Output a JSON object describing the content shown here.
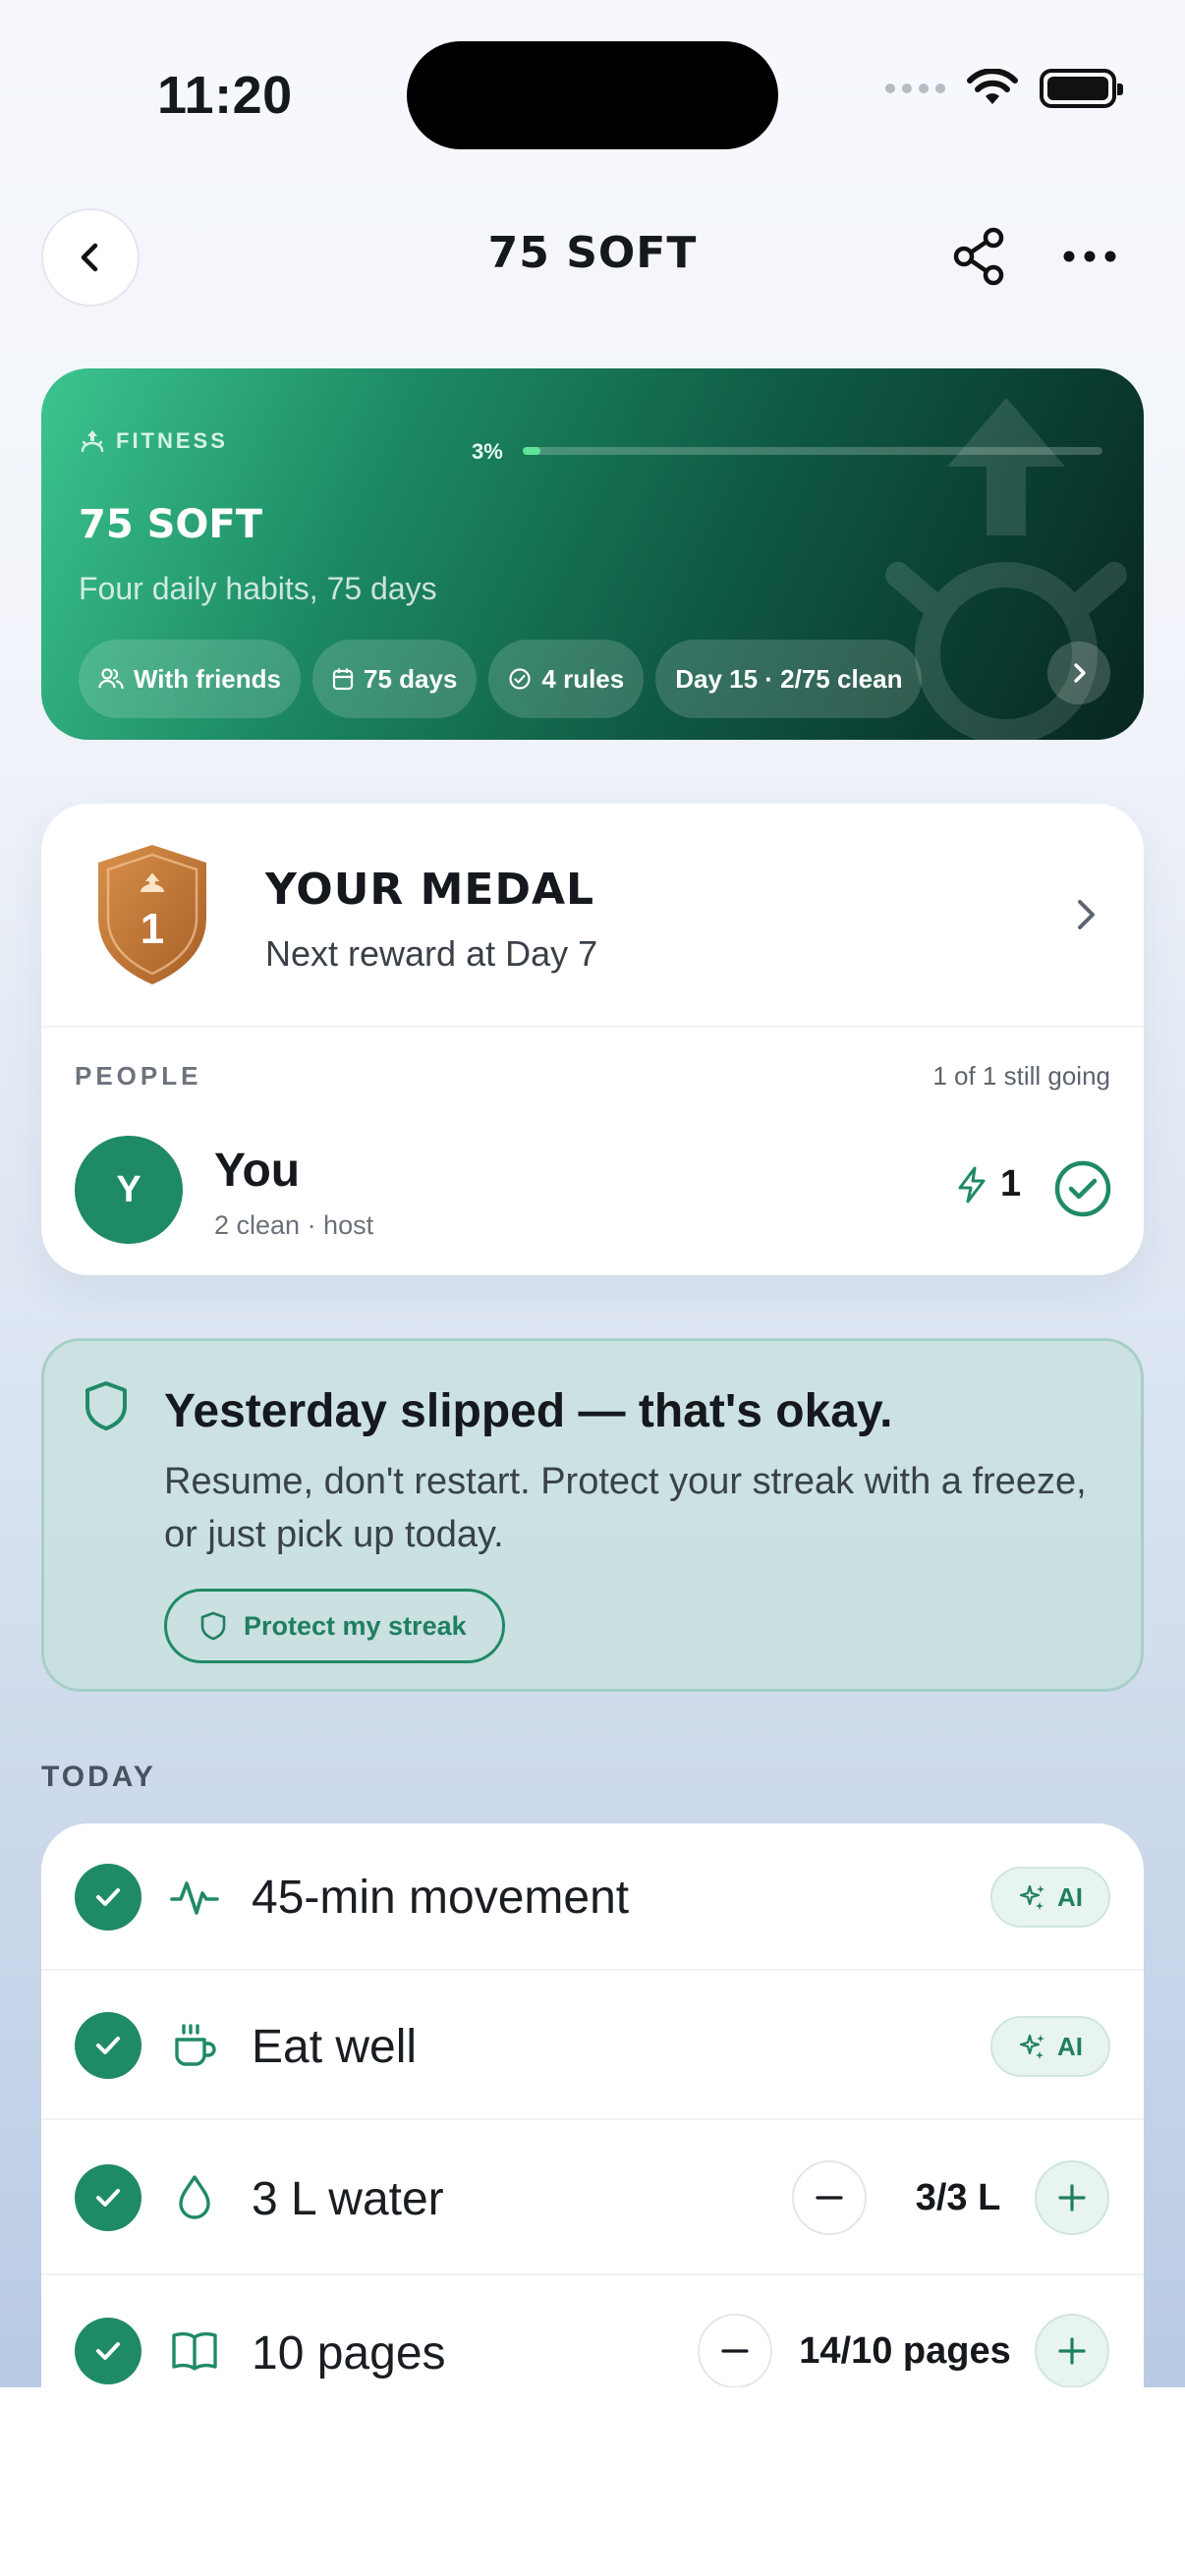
{
  "status_bar": {
    "time": "11:20"
  },
  "nav": {
    "title": "75 SOFT"
  },
  "hero": {
    "category": "FITNESS",
    "progress_label": "3%",
    "progress_fraction": 0.03,
    "title": "75 SOFT",
    "subtitle": "Four daily habits, 75 days",
    "chips": [
      {
        "icon": "people-icon",
        "label": "With friends"
      },
      {
        "icon": "calendar-icon",
        "label": "75 days"
      },
      {
        "icon": "check-circle-icon",
        "label": "4 rules"
      },
      {
        "icon": "",
        "label": "Day 15 · 2/75 clean"
      }
    ]
  },
  "medal": {
    "number": "1",
    "title": "YOUR MEDAL",
    "subtitle": "Next reward at Day 7"
  },
  "people": {
    "label": "PEOPLE",
    "count": "1 of 1 still going",
    "members": [
      {
        "initial": "Y",
        "name": "You",
        "detail": "2 clean · host",
        "streak": "1"
      }
    ]
  },
  "slip": {
    "title": "Yesterday slipped — that's okay.",
    "body": "Resume, don't restart. Protect your streak with a freeze, or just pick up today.",
    "button": "Protect my streak"
  },
  "today": {
    "label": "TODAY",
    "items": [
      {
        "icon": "activity-icon",
        "label": "45-min movement",
        "action": "AI"
      },
      {
        "icon": "coffee-cup-icon",
        "label": "Eat well",
        "action": "AI"
      },
      {
        "icon": "droplet-icon",
        "label": "3 L water",
        "count": "3/3 L"
      },
      {
        "icon": "book-icon",
        "label": "10 pages",
        "count": "14/10 pages"
      }
    ]
  },
  "colors": {
    "accent": "#1f8a66",
    "hero_start": "#3cc58f",
    "hero_end": "#07251f",
    "medal_bronze": "#c47a3a",
    "slip_bg": "#c6e0dc"
  }
}
